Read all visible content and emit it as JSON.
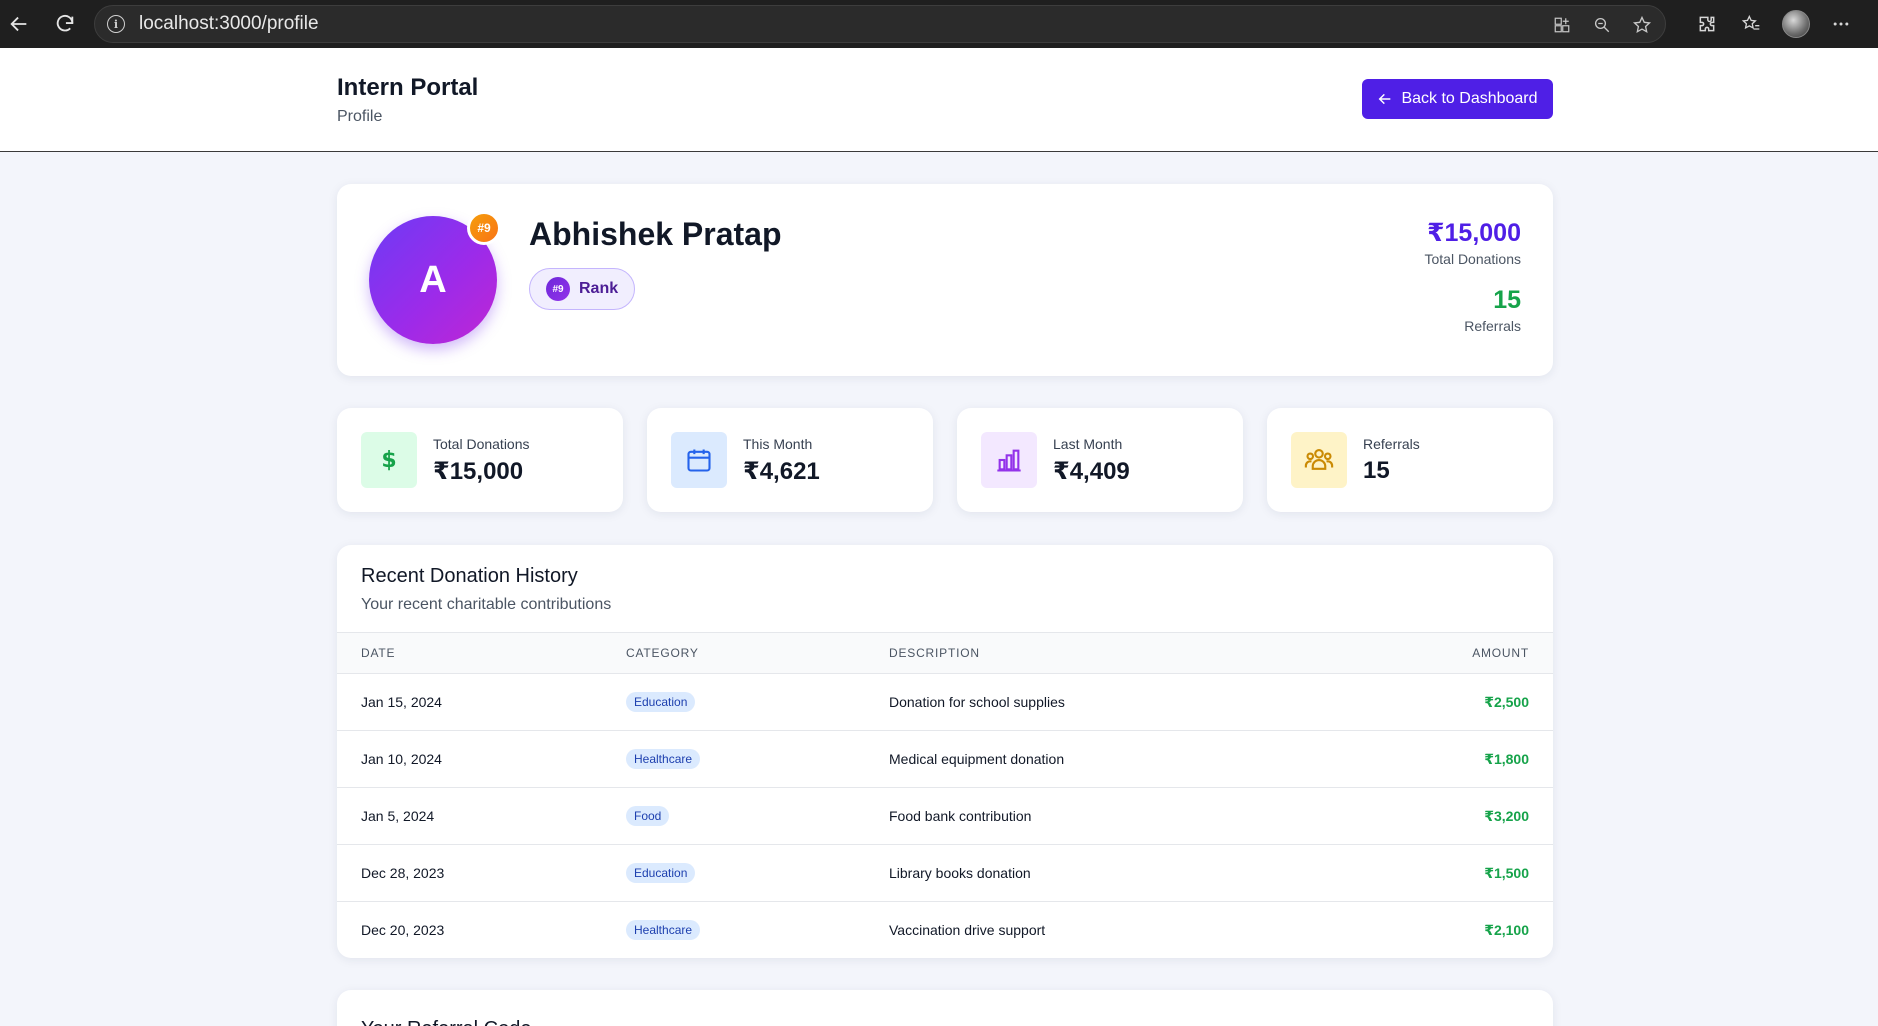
{
  "browser": {
    "url": "localhost:3000/profile"
  },
  "header": {
    "app_title": "Intern Portal",
    "page_subtitle": "Profile",
    "back_button_label": "Back to Dashboard"
  },
  "profile": {
    "avatar_initial": "A",
    "rank_badge": "#9",
    "name": "Abhishek Pratap",
    "rank_pill_number": "#9",
    "rank_pill_label": "Rank",
    "total_donations_value": "₹15,000",
    "total_donations_label": "Total Donations",
    "referrals_value": "15",
    "referrals_label": "Referrals"
  },
  "stats": [
    {
      "label": "Total Donations",
      "value": "₹15,000",
      "icon": "dollar-icon",
      "color": "#16a34a"
    },
    {
      "label": "This Month",
      "value": "₹4,621",
      "icon": "calendar-icon",
      "color": "#2563eb"
    },
    {
      "label": "Last Month",
      "value": "₹4,409",
      "icon": "bar-chart-icon",
      "color": "#9333ea"
    },
    {
      "label": "Referrals",
      "value": "15",
      "icon": "users-icon",
      "color": "#ca8a04"
    }
  ],
  "history": {
    "title": "Recent Donation History",
    "subtitle": "Your recent charitable contributions",
    "columns": [
      "DATE",
      "CATEGORY",
      "DESCRIPTION",
      "AMOUNT"
    ],
    "rows": [
      {
        "date": "Jan 15, 2024",
        "category": "Education",
        "description": "Donation for school supplies",
        "amount": "₹2,500"
      },
      {
        "date": "Jan 10, 2024",
        "category": "Healthcare",
        "description": "Medical equipment donation",
        "amount": "₹1,800"
      },
      {
        "date": "Jan 5, 2024",
        "category": "Food",
        "description": "Food bank contribution",
        "amount": "₹3,200"
      },
      {
        "date": "Dec 28, 2023",
        "category": "Education",
        "description": "Library books donation",
        "amount": "₹1,500"
      },
      {
        "date": "Dec 20, 2023",
        "category": "Healthcare",
        "description": "Vaccination drive support",
        "amount": "₹2,100"
      }
    ]
  },
  "referral": {
    "title": "Your Referral Code"
  },
  "colors": {
    "accent": "#4f1fe6",
    "success": "#16a34a"
  }
}
